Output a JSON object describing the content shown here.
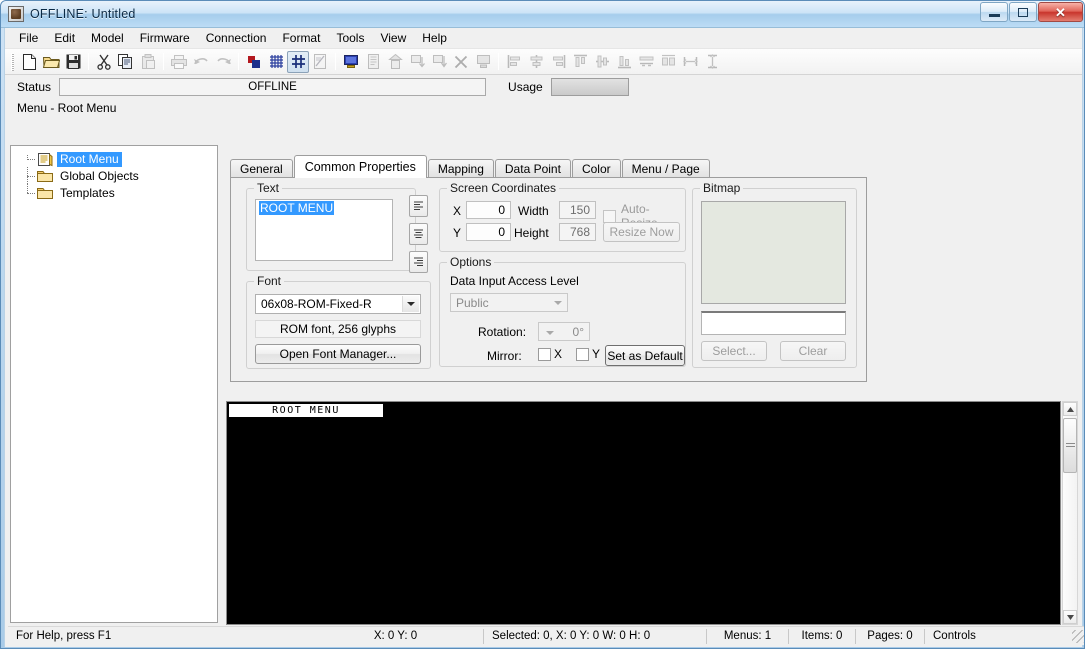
{
  "window": {
    "title": "OFFLINE: Untitled",
    "app_icon": "app-icon",
    "minimize_label": "Minimize",
    "maximize_label": "Restore",
    "close_label": "Close",
    "close_glyph": "✕"
  },
  "menubar": {
    "items": [
      {
        "label": "File"
      },
      {
        "label": "Edit"
      },
      {
        "label": "Model"
      },
      {
        "label": "Firmware"
      },
      {
        "label": "Connection"
      },
      {
        "label": "Format"
      },
      {
        "label": "Tools"
      },
      {
        "label": "View"
      },
      {
        "label": "Help"
      }
    ]
  },
  "toolbar": {
    "buttons": [
      {
        "name": "new-icon",
        "enabled": true
      },
      {
        "name": "open-folder-icon",
        "enabled": true
      },
      {
        "name": "save-disk-icon",
        "enabled": true
      },
      {
        "name": "cut-scissors-icon",
        "enabled": true
      },
      {
        "name": "copy-icon",
        "enabled": true
      },
      {
        "name": "paste-icon",
        "enabled": false
      },
      {
        "name": "print-icon",
        "enabled": false
      },
      {
        "name": "undo-arrow-icon",
        "enabled": false
      },
      {
        "name": "redo-arrow-icon",
        "enabled": false
      },
      {
        "name": "color-swatch-icon",
        "enabled": true
      },
      {
        "name": "grid-show-icon",
        "enabled": true
      },
      {
        "name": "snap-to-grid-icon",
        "enabled": true,
        "pressed": true
      },
      {
        "name": "edit-page-icon",
        "enabled": false
      },
      {
        "name": "monitor-preview-icon",
        "enabled": true
      },
      {
        "name": "import-menu-icon",
        "enabled": false
      },
      {
        "name": "export-menu-icon",
        "enabled": false
      },
      {
        "name": "insert-above-icon",
        "enabled": false
      },
      {
        "name": "insert-below-icon",
        "enabled": false
      },
      {
        "name": "delete-x-icon",
        "enabled": false
      },
      {
        "name": "display-item-icon",
        "enabled": false
      },
      {
        "name": "align-left-icon",
        "enabled": false
      },
      {
        "name": "align-center-h-icon",
        "enabled": false
      },
      {
        "name": "align-right-icon",
        "enabled": false
      },
      {
        "name": "align-top-icon",
        "enabled": false
      },
      {
        "name": "align-middle-v-icon",
        "enabled": false
      },
      {
        "name": "align-bottom-icon",
        "enabled": false
      },
      {
        "name": "distribute-icon",
        "enabled": false
      },
      {
        "name": "size-equal-icon",
        "enabled": false
      },
      {
        "name": "space-horizontal-icon",
        "enabled": false
      },
      {
        "name": "space-vertical-icon",
        "enabled": false
      }
    ]
  },
  "status_strip": {
    "status_label": "Status",
    "status_value": "OFFLINE",
    "usage_label": "Usage",
    "usage_percent": 0
  },
  "menu_path": "Menu - Root Menu",
  "tree": {
    "items": [
      {
        "label": "Root Menu",
        "icon": "menu-list-icon",
        "selected": true
      },
      {
        "label": "Global Objects",
        "icon": "folder-icon",
        "selected": false
      },
      {
        "label": "Templates",
        "icon": "folder-icon",
        "selected": false
      }
    ]
  },
  "tabs": [
    {
      "label": "General",
      "active": false
    },
    {
      "label": "Common Properties",
      "active": true
    },
    {
      "label": "Mapping",
      "active": false
    },
    {
      "label": "Data Point",
      "active": false
    },
    {
      "label": "Color",
      "active": false
    },
    {
      "label": "Menu / Page",
      "active": false
    }
  ],
  "text_group": {
    "legend": "Text",
    "value": "ROOT MENU",
    "align_buttons": [
      {
        "name": "align-left-text-icon"
      },
      {
        "name": "align-center-text-icon"
      },
      {
        "name": "align-right-text-icon"
      }
    ]
  },
  "font_group": {
    "legend": "Font",
    "selected_font": "06x08-ROM-Fixed-R",
    "font_info": "ROM font, 256 glyphs",
    "manager_button": "Open Font Manager..."
  },
  "screen_coordinates": {
    "legend": "Screen Coordinates",
    "x_label": "X",
    "x_value": "0",
    "y_label": "Y",
    "y_value": "0",
    "width_label": "Width",
    "width_value": "150",
    "height_label": "Height",
    "height_value": "768",
    "auto_resize_label": "Auto-Resize",
    "auto_resize_checked": false,
    "resize_now_button": "Resize Now",
    "resize_now_enabled": false
  },
  "options": {
    "legend": "Options",
    "access_level_label": "Data Input Access Level",
    "access_level_value": "Public",
    "access_level_enabled": false,
    "rotation_label": "Rotation:",
    "rotation_value": "0°",
    "rotation_enabled": false,
    "mirror_label": "Mirror:",
    "mirror_x_label": "X",
    "mirror_x_checked": false,
    "mirror_y_label": "Y",
    "mirror_y_checked": false,
    "set_default_button": "Set as Default"
  },
  "bitmap": {
    "legend": "Bitmap",
    "preview_color": "#e4e8e0",
    "path_value": "",
    "select_button": "Select...",
    "clear_button": "Clear",
    "buttons_enabled": false
  },
  "canvas": {
    "menu_title": "ROOT MENU",
    "background_color": "#000000"
  },
  "statusbar": {
    "help_text": "For Help, press F1",
    "cursor_position": "X: 0 Y: 0",
    "selection_info": "Selected: 0, X: 0 Y: 0 W: 0 H: 0",
    "menus": "Menus: 1",
    "items": "Items: 0",
    "pages": "Pages: 0",
    "controls": "Controls"
  },
  "colors": {
    "accent_selection": "#3399ff",
    "titlebar_text": "#0b2a45",
    "close_button": "#c8352c",
    "canvas_black": "#000000"
  }
}
